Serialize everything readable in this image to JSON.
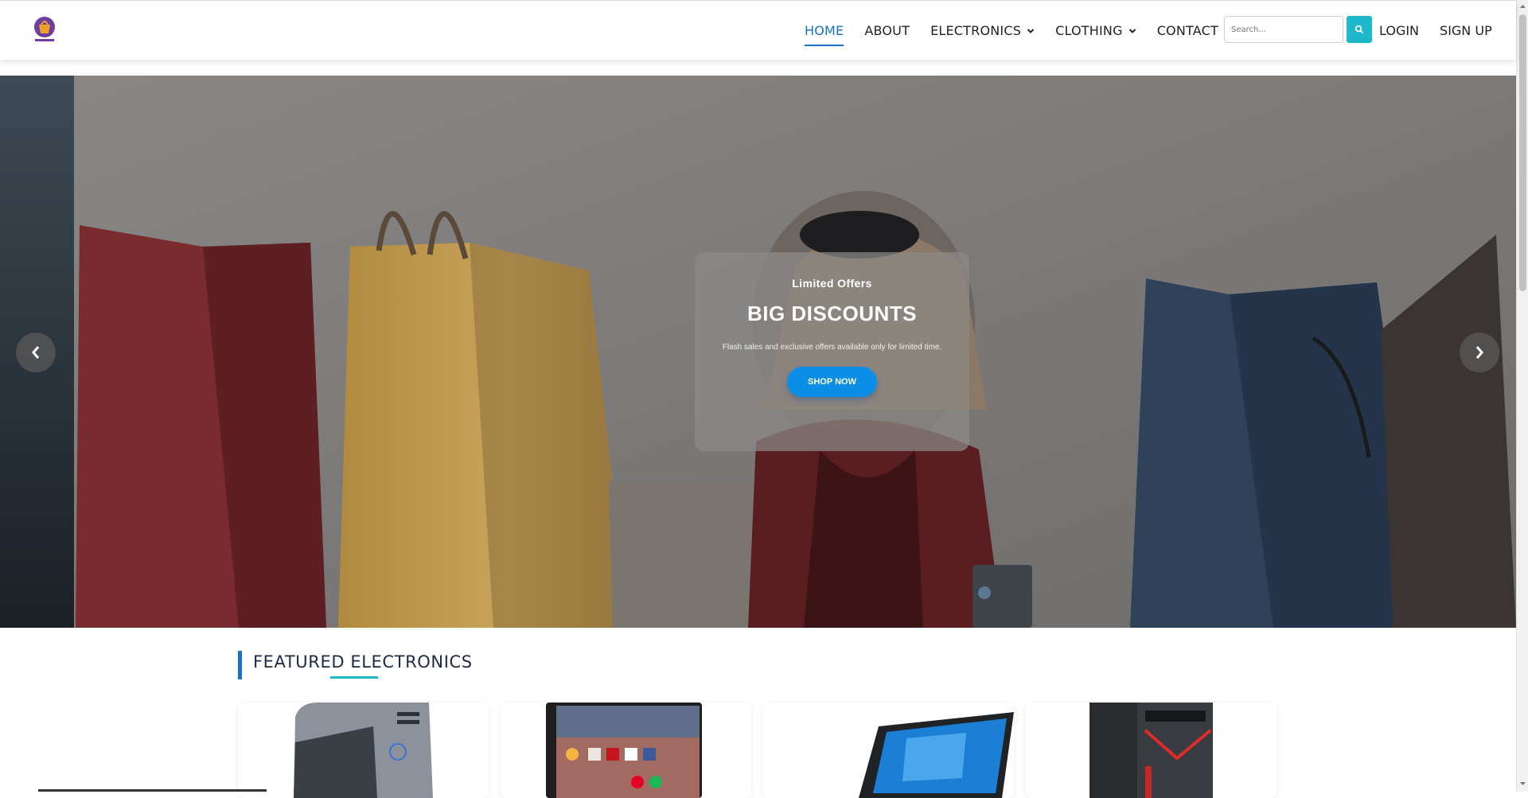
{
  "header": {
    "logo_icon": "shopping-bag-logo-icon",
    "nav": [
      {
        "label": "HOME",
        "active": true
      },
      {
        "label": "ABOUT",
        "active": false
      },
      {
        "label": "ELECTRONICS",
        "active": false,
        "dropdown": true
      },
      {
        "label": "CLOTHING",
        "active": false,
        "dropdown": true
      },
      {
        "label": "CONTACT",
        "active": false
      }
    ],
    "search": {
      "placeholder": "Search...",
      "icon": "search-icon"
    },
    "login_label": "LOGIN",
    "signup_label": "SIGN UP"
  },
  "hero": {
    "eyebrow": "Limited Offers",
    "title": "BIG DISCOUNTS",
    "text": "Flash sales and exclusive offers available only for limited time.",
    "cta_label": "SHOP NOW",
    "prev_icon": "chevron-left-icon",
    "next_icon": "chevron-right-icon"
  },
  "featured": {
    "title": "FEATURED ELECTRONICS",
    "products": [
      {
        "image": "desktop-tower-pc"
      },
      {
        "image": "tablet"
      },
      {
        "image": "laptop"
      },
      {
        "image": "gaming-pc-tower"
      }
    ]
  },
  "colors": {
    "accent": "#1572c9",
    "search_button": "#1eb7cc",
    "cta": "#0b8ee6",
    "heading": "#1d2a44"
  }
}
